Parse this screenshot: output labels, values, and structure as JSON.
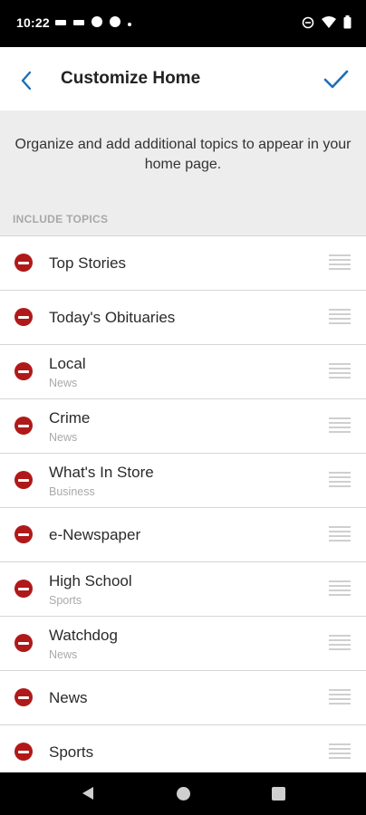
{
  "status_bar": {
    "time": "10:22",
    "left_icons": [
      "notification-icon",
      "notification-icon",
      "app-icon",
      "app-icon",
      "dot-icon"
    ],
    "right_icons": [
      "do-not-disturb-icon",
      "wifi-icon",
      "battery-icon"
    ]
  },
  "header": {
    "title": "Customize Home",
    "back_icon": "chevron-left-icon",
    "done_icon": "checkmark-icon",
    "accent_color": "#1e6fb8"
  },
  "info": {
    "text": "Organize and add additional topics to appear in your home page."
  },
  "section": {
    "label": "INCLUDE TOPICS"
  },
  "topics": [
    {
      "title": "Top Stories",
      "subtitle": ""
    },
    {
      "title": "Today's Obituaries",
      "subtitle": ""
    },
    {
      "title": "Local",
      "subtitle": "News"
    },
    {
      "title": "Crime",
      "subtitle": "News"
    },
    {
      "title": "What's In Store",
      "subtitle": "Business"
    },
    {
      "title": "e-Newspaper",
      "subtitle": ""
    },
    {
      "title": "High School",
      "subtitle": "Sports"
    },
    {
      "title": "Watchdog",
      "subtitle": "News"
    },
    {
      "title": "News",
      "subtitle": ""
    },
    {
      "title": "Sports",
      "subtitle": ""
    }
  ],
  "colors": {
    "remove": "#b01919",
    "info_bg": "#ededed"
  },
  "nav_bar": {
    "buttons": [
      "back-icon",
      "home-icon",
      "recent-apps-icon"
    ]
  }
}
